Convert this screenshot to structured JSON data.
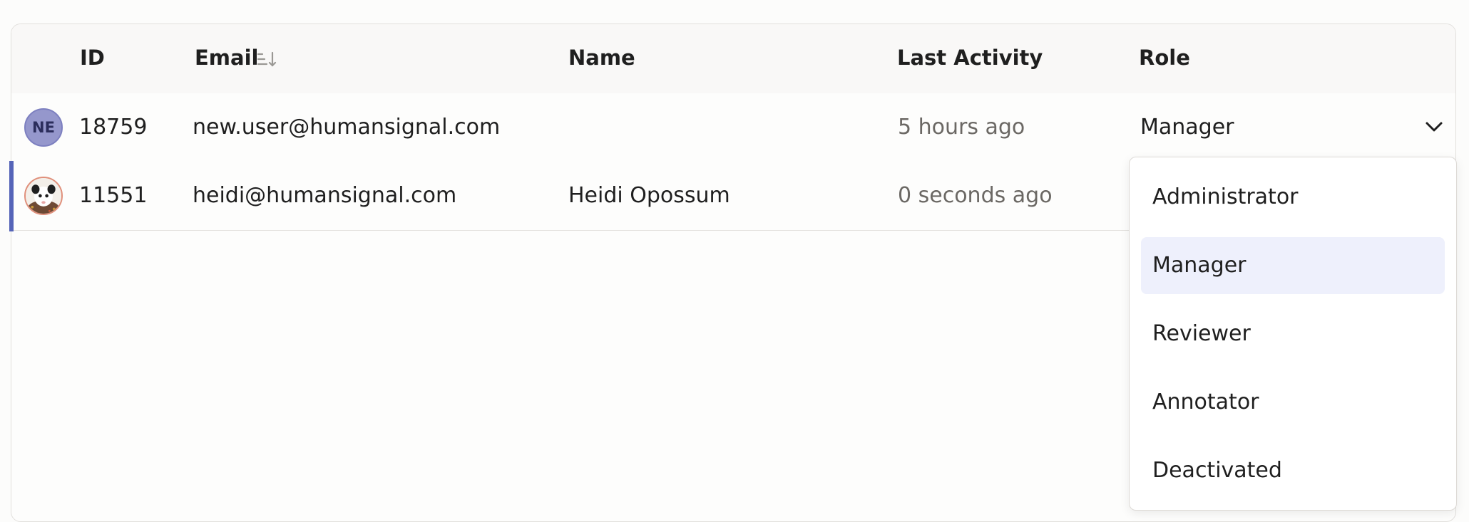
{
  "table": {
    "columns": {
      "id": "ID",
      "email": "Email",
      "name": "Name",
      "last_activity": "Last Activity",
      "role": "Role"
    },
    "sort_icon": "sort-descending-icon",
    "rows": [
      {
        "avatar_initials": "NE",
        "avatar_color": "#9597cc",
        "id": "18759",
        "email": "new.user@humansignal.com",
        "name": "",
        "last_activity": "5 hours ago",
        "role": "Manager"
      },
      {
        "avatar_type": "photo",
        "id": "11551",
        "email": "heidi@humansignal.com",
        "name": "Heidi Opossum",
        "last_activity": "0 seconds ago"
      }
    ]
  },
  "role_dropdown": {
    "options": [
      "Administrator",
      "Manager",
      "Reviewer",
      "Annotator",
      "Deactivated"
    ],
    "selected": "Manager",
    "highlight_color": "#eef0fc"
  },
  "accent_color": "#5564b8"
}
